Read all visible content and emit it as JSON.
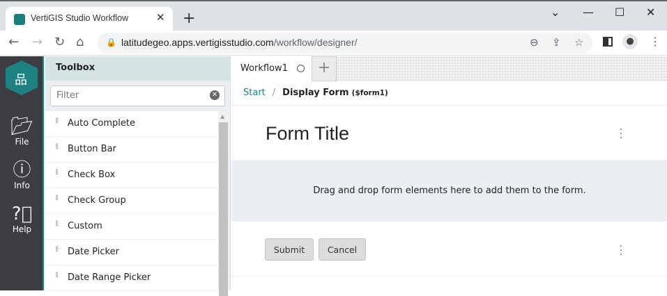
{
  "browser": {
    "tab_title": "VertiGIS Studio Workflow",
    "url_host": "latitudegeo.apps.vertigisstudio.com",
    "url_path": "/workflow/designer/"
  },
  "rail": {
    "items": [
      {
        "label": "File",
        "icon": "folder-icon"
      },
      {
        "label": "Info",
        "icon": "info-icon"
      },
      {
        "label": "Help",
        "icon": "help-icon"
      }
    ]
  },
  "toolbox": {
    "title": "Toolbox",
    "filter_placeholder": "Filter",
    "filter_value": "",
    "items": [
      {
        "label": "Auto Complete"
      },
      {
        "label": "Button Bar"
      },
      {
        "label": "Check Box"
      },
      {
        "label": "Check Group"
      },
      {
        "label": "Custom"
      },
      {
        "label": "Date Picker"
      },
      {
        "label": "Date Range Picker"
      }
    ]
  },
  "main": {
    "tab_label": "Workflow1",
    "breadcrumb": {
      "start": "Start",
      "separator": "/",
      "current": "Display Form",
      "current_id": "($form1)"
    },
    "form_title": "Form Title",
    "drop_hint": "Drag and drop form elements here to add them to the form.",
    "submit_label": "Submit",
    "cancel_label": "Cancel"
  },
  "colors": {
    "accent": "#1e7f80",
    "rail_bg": "#3d3c41"
  }
}
